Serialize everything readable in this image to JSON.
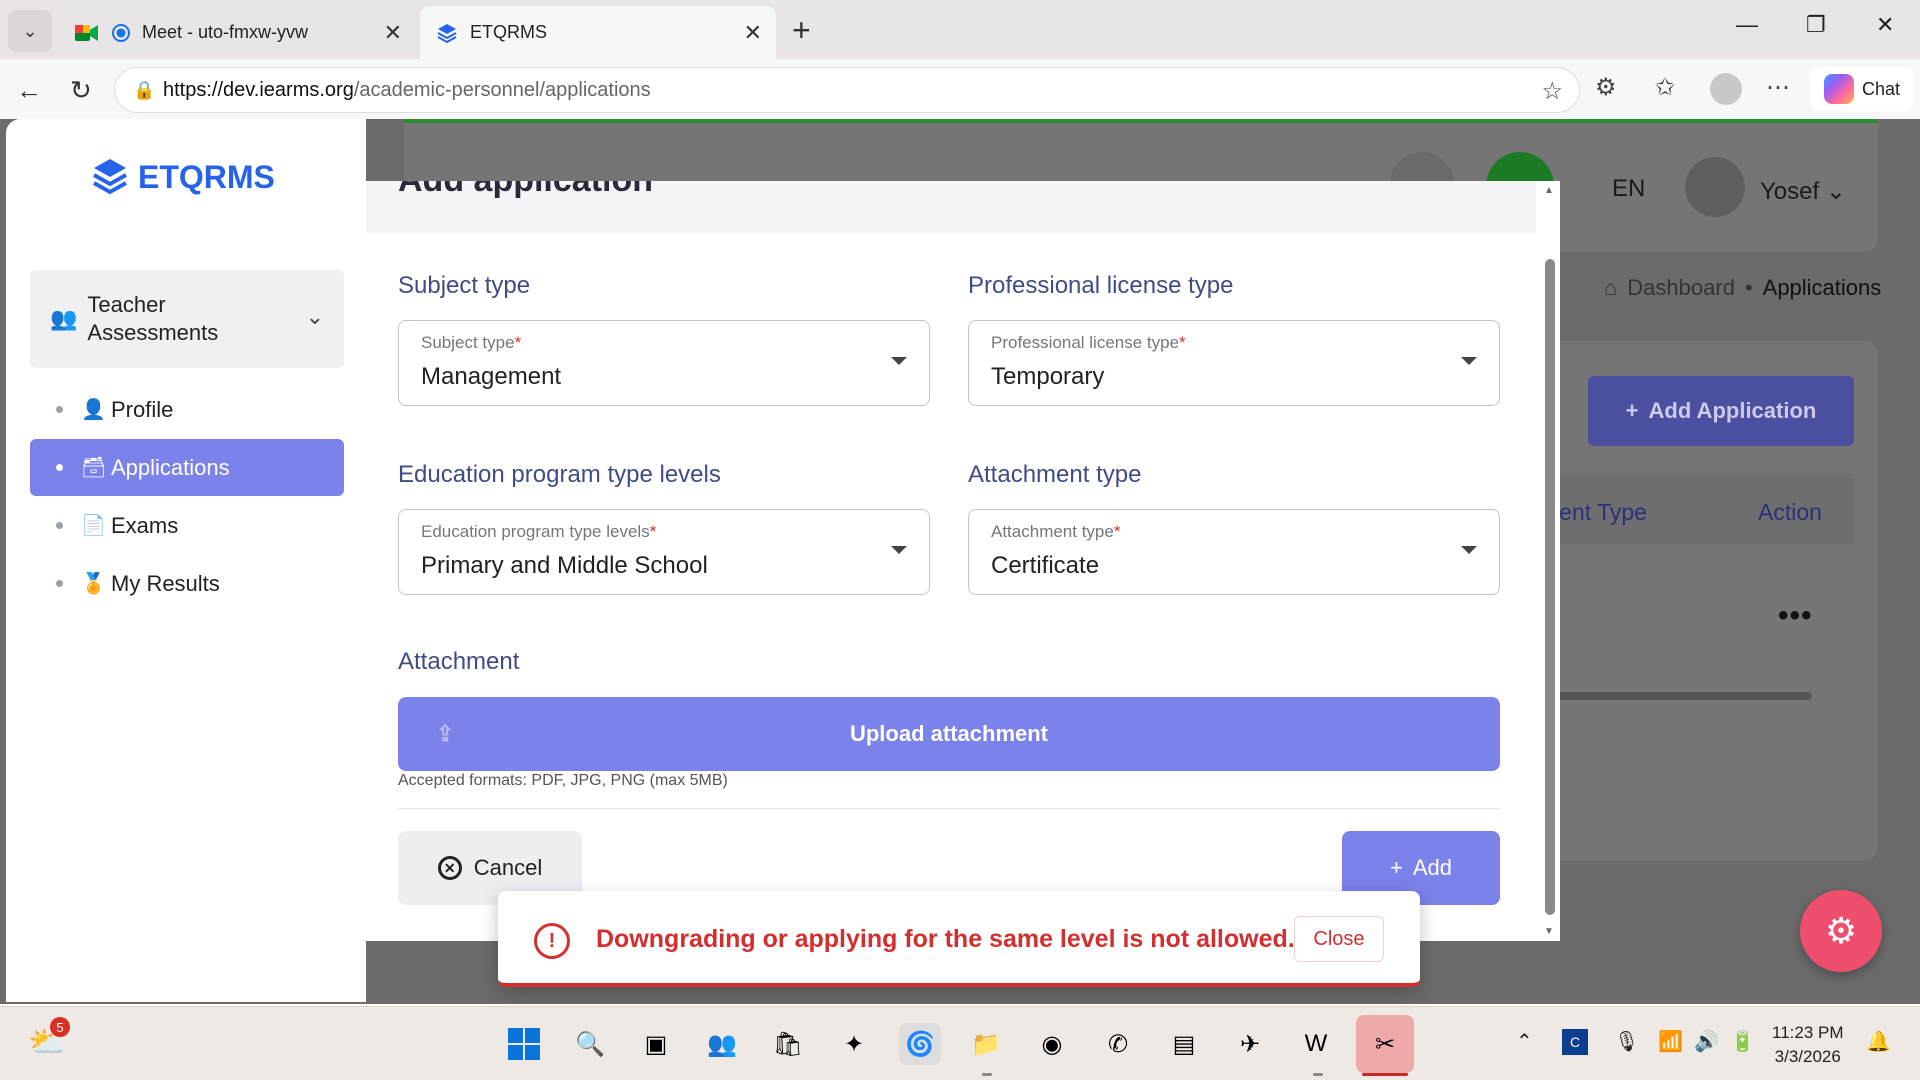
{
  "browser": {
    "tabs": [
      {
        "title": "Meet - uto-fmxw-yvw",
        "active": false
      },
      {
        "title": "ETQRMS",
        "active": true
      }
    ],
    "url_host": "https://dev.iearms.org",
    "url_path": "/academic-personnel/applications",
    "chat_label": "Chat"
  },
  "sidebar": {
    "logo_text": "ETQRMS",
    "group_label": "Teacher Assessments",
    "items": [
      {
        "label": "Profile",
        "icon": "user-icon",
        "active": false
      },
      {
        "label": "Applications",
        "icon": "archive-icon",
        "active": true
      },
      {
        "label": "Exams",
        "icon": "document-icon",
        "active": false
      },
      {
        "label": "My Results",
        "icon": "medal-icon",
        "active": false
      }
    ]
  },
  "background": {
    "language": "EN",
    "user_name": "Yosef",
    "breadcrumb": {
      "home": "Dashboard",
      "current": "Applications"
    },
    "add_button": "Add Application",
    "table_headers": [
      "ment Type",
      "Action"
    ],
    "row_action": "•••"
  },
  "modal": {
    "title": "Add application",
    "fields": {
      "subject_type": {
        "section": "Subject type",
        "label": "Subject type",
        "value": "Management"
      },
      "license_type": {
        "section": "Professional license type",
        "label": "Professional license type",
        "value": "Temporary"
      },
      "program_levels": {
        "section": "Education program type levels",
        "label": "Education program type levels",
        "value": "Primary and Middle School"
      },
      "attachment_type": {
        "section": "Attachment type",
        "label": "Attachment type",
        "value": "Certificate"
      }
    },
    "attachment_section": "Attachment",
    "upload_label": "Upload attachment",
    "formats_hint": "Accepted formats: PDF, JPG, PNG (max 5MB)",
    "cancel_label": "Cancel",
    "add_label": "Add",
    "required_mark": "*"
  },
  "toast": {
    "message": "Downgrading or applying for the same level is not allowed.",
    "close_label": "Close"
  },
  "taskbar": {
    "weather_badge": "5",
    "time": "11:23 PM",
    "date": "3/3/2026"
  },
  "colors": {
    "primary": "#7b82ea",
    "error": "#d32f2f",
    "brand": "#2563eb",
    "fab": "#ef4f6e"
  }
}
